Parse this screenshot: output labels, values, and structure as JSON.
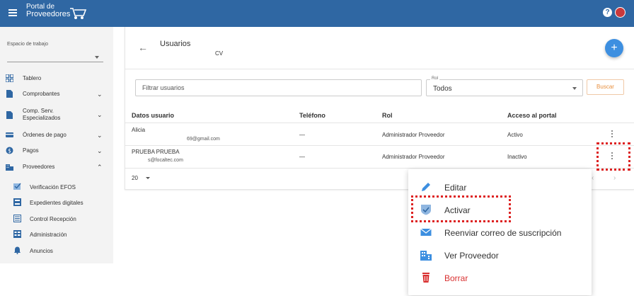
{
  "header": {
    "logo_line1": "Portal de",
    "logo_line2": "Proveedores"
  },
  "sidebar": {
    "workspace_label": "Espacio de trabajo",
    "workspace_value": "",
    "items": [
      {
        "label": "Tablero",
        "icon": "dashboard-icon",
        "has_chevron": false
      },
      {
        "label": "Comprobantes",
        "icon": "document-icon",
        "has_chevron": true,
        "chevron": "⌄"
      },
      {
        "label": "Comp. Serv.\nEspecializados",
        "icon": "document-icon",
        "has_chevron": true,
        "chevron": "⌄"
      },
      {
        "label": "Órdenes de pago",
        "icon": "card-icon",
        "has_chevron": true,
        "chevron": "⌄"
      },
      {
        "label": "Pagos",
        "icon": "dollar-icon",
        "has_chevron": true,
        "chevron": "⌄"
      },
      {
        "label": "Proveedores",
        "icon": "building-icon",
        "has_chevron": true,
        "chevron": "⌃"
      }
    ],
    "sub_items": [
      {
        "label": "Verificación EFOS",
        "icon": "verify-icon"
      },
      {
        "label": "Expedientes digitales",
        "icon": "folder-icon"
      },
      {
        "label": "Control Recepción",
        "icon": "list-icon"
      },
      {
        "label": "Administración",
        "icon": "table-icon"
      },
      {
        "label": "Anuncios",
        "icon": "bell-icon"
      }
    ]
  },
  "main": {
    "title": "Usuarios",
    "subtitle": "CV",
    "filter_placeholder": "Filtrar usuarios",
    "rol_label": "Rol",
    "rol_value": "Todos",
    "search_button": "Buscar",
    "table": {
      "headers": [
        "Datos usuario",
        "Teléfono",
        "Rol",
        "Acceso al portal"
      ],
      "rows": [
        {
          "name": "Alicia",
          "email": "69@gmail.com",
          "phone": "—",
          "role": "Administrador Proveedor",
          "access": "Activo"
        },
        {
          "name": "PRUEBA PRUEBA",
          "email": "s@focaltec.com",
          "phone": "—",
          "role": "Administrador Proveedor",
          "access": "Inactivo"
        }
      ]
    },
    "pager_size": "20"
  },
  "context_menu": {
    "items": [
      {
        "label": "Editar",
        "icon": "pencil-icon"
      },
      {
        "label": "Activar",
        "icon": "shield-check-icon"
      },
      {
        "label": "Reenviar correo de suscripción",
        "icon": "mail-icon"
      },
      {
        "label": "Ver Proveedor",
        "icon": "building-icon"
      },
      {
        "label": "Borrar",
        "icon": "trash-icon"
      }
    ]
  },
  "colors": {
    "topbar": "#2f67a3",
    "accent": "#3d8fe0",
    "danger": "#d93030",
    "highlight": "#dd2222"
  }
}
